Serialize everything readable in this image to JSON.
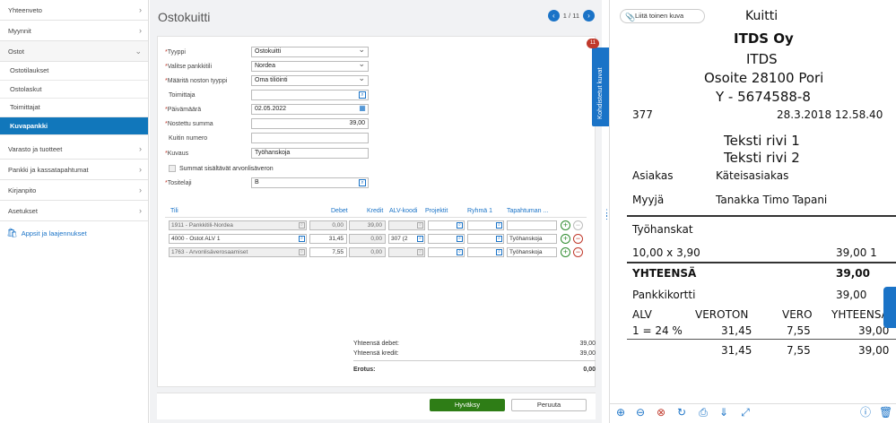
{
  "sidebar": {
    "items": [
      {
        "label": "Yhteenveto"
      },
      {
        "label": "Myynnit"
      },
      {
        "label": "Ostot"
      }
    ],
    "ostot_sub": [
      {
        "label": "Ostotilaukset"
      },
      {
        "label": "Ostolaskut"
      },
      {
        "label": "Toimittajat"
      },
      {
        "label": "Kuvapankki"
      }
    ],
    "items2": [
      {
        "label": "Varasto ja tuotteet"
      },
      {
        "label": "Pankki ja kassatapahtumat"
      },
      {
        "label": "Kirjanpito"
      },
      {
        "label": "Asetukset"
      }
    ],
    "apps_label": "Appsit ja laajennukset"
  },
  "header": {
    "title": "Ostokuitti",
    "pager": "1 / 11"
  },
  "form": {
    "tyyppi": {
      "label": "Tyyppi",
      "value": "Ostokuitti"
    },
    "pankkitili": {
      "label": "Valitse pankkitili",
      "value": "Nordea"
    },
    "noston_tyyppi": {
      "label": "Määritä noston tyyppi",
      "value": "Oma tiliöinti"
    },
    "toimittaja": {
      "label": "Toimittaja",
      "value": ""
    },
    "paivamaara": {
      "label": "Päivämäärä",
      "value": "02.05.2022"
    },
    "summa": {
      "label": "Nostettu summa",
      "value": "39,00"
    },
    "kuitin_numero": {
      "label": "Kuitin numero",
      "value": ""
    },
    "kuvaus": {
      "label": "Kuvaus",
      "value": "Työhanskoja"
    },
    "alv_checkbox": {
      "label": "Summat sisältävät arvonlisäveron"
    },
    "tositelaji": {
      "label": "Tositelaji",
      "value": "B"
    }
  },
  "table": {
    "headers": {
      "tili": "Tili",
      "debet": "Debet",
      "kredit": "Kredit",
      "alv": "ALV-koodi",
      "projektit": "Projektit",
      "ryhma": "Ryhmä 1",
      "tapahtuma": "Tapahtuman ..."
    },
    "rows": [
      {
        "tili": "1911 - Pankkitili-Nordea",
        "debet": "0,00",
        "kredit": "39,00",
        "alv": "",
        "tapahtuma": ""
      },
      {
        "tili": "4000 - Ostot ALV 1",
        "debet": "31,45",
        "kredit": "0,00",
        "alv": "307 (2",
        "tapahtuma": "Työhanskoja"
      },
      {
        "tili": "1763 - Arvonlisäverosaamiset",
        "debet": "7,55",
        "kredit": "0,00",
        "alv": "",
        "tapahtuma": "Työhanskoja"
      }
    ]
  },
  "totals": {
    "debet_label": "Yhteensä debet:",
    "debet": "39,00",
    "kredit_label": "Yhteensä kredit:",
    "kredit": "39,00",
    "erotus_label": "Erotus:",
    "erotus": "0,00"
  },
  "buttons": {
    "approve": "Hyväksy",
    "cancel": "Peruuta"
  },
  "side_tab": {
    "label": "Kohdistetut kuvat",
    "badge": "11"
  },
  "viewer": {
    "attach_label": "Liitä toinen kuva",
    "receipt": {
      "kuitti": "Kuitti",
      "company": "ITDS Oy",
      "name": "ITDS",
      "address": "Osoite 28100 Pori",
      "ytunnus": "Y - 5674588-8",
      "number": "377",
      "datetime": "28.3.2018 12.58.40",
      "teksti1": "Teksti rivi 1",
      "teksti2": "Teksti rivi 2",
      "asiakas_label": "Asiakas",
      "asiakas_value": "Käteisasiakas",
      "myyja_label": "Myyjä",
      "myyja_value": "Tanakka Timo Tapani",
      "item_name": "Työhanskat",
      "item_qty": "10,00  x 3,90",
      "item_total": "39,00 1",
      "total_label": "YHTEENSÄ",
      "total_value": "39,00",
      "payment_label": "Pankkikortti",
      "payment_value": "39,00",
      "vat_headers": [
        "ALV",
        "VEROTON",
        "VERO",
        "YHTEENSÄ"
      ],
      "vat_row": [
        "1 = 24 %",
        "31,45",
        "7,55",
        "39,00"
      ],
      "vat_sum": [
        "31,45",
        "7,55",
        "39,00"
      ]
    }
  }
}
